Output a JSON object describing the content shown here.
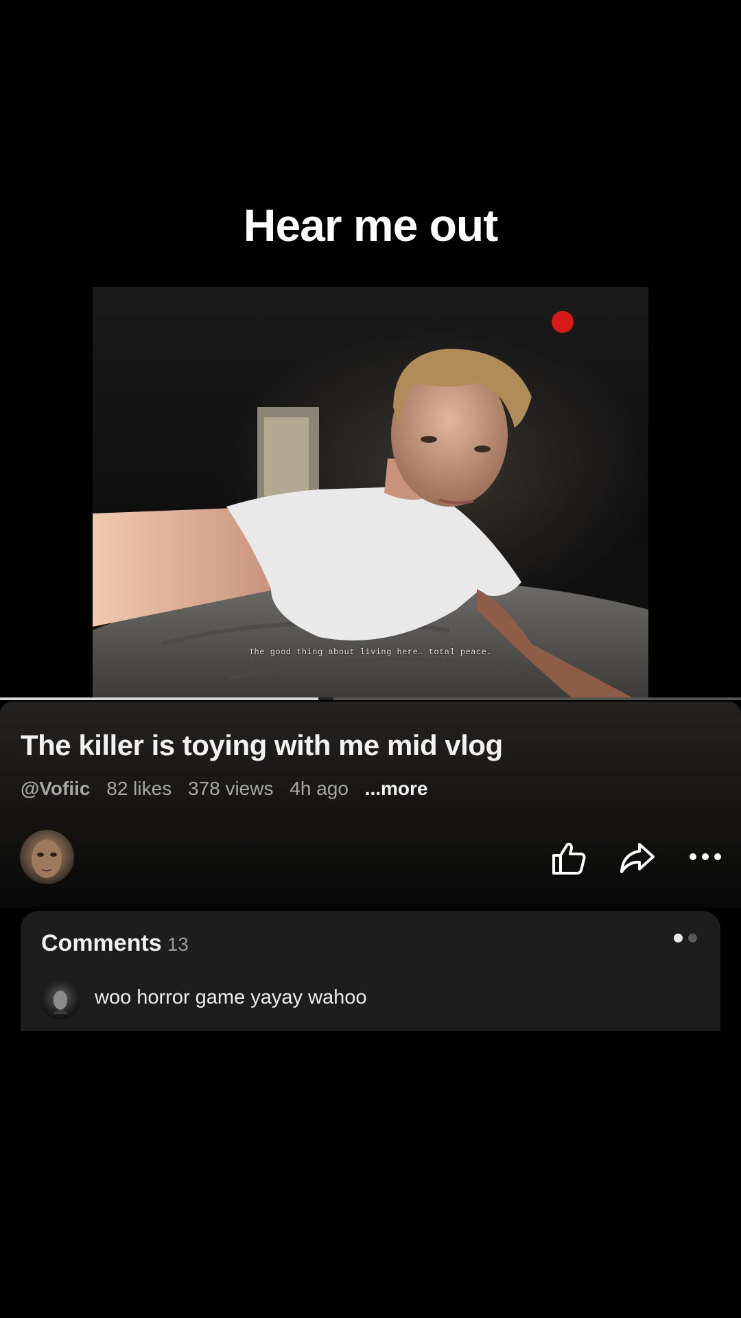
{
  "caption": "Hear me out",
  "video": {
    "subtitle": "The good thing about living here… total peace.",
    "progress": 0.43
  },
  "info": {
    "title": "The killer is toying with me mid vlog",
    "handle": "@Vofiic",
    "likes": "82 likes",
    "views": "378 views",
    "time": "4h ago",
    "more": "...more"
  },
  "actions": {
    "like_icon": "thumbs-up-icon",
    "share_icon": "share-arrow-icon",
    "more_icon": "more-dots-icon"
  },
  "comments": {
    "title": "Comments",
    "count": "13",
    "top_comment": "woo horror game yayay wahoo"
  },
  "colors": {
    "background": "#000000",
    "panel": "#1d1d1d",
    "progress_fill": "#d8d8d8",
    "record_dot": "#d61a1a"
  }
}
